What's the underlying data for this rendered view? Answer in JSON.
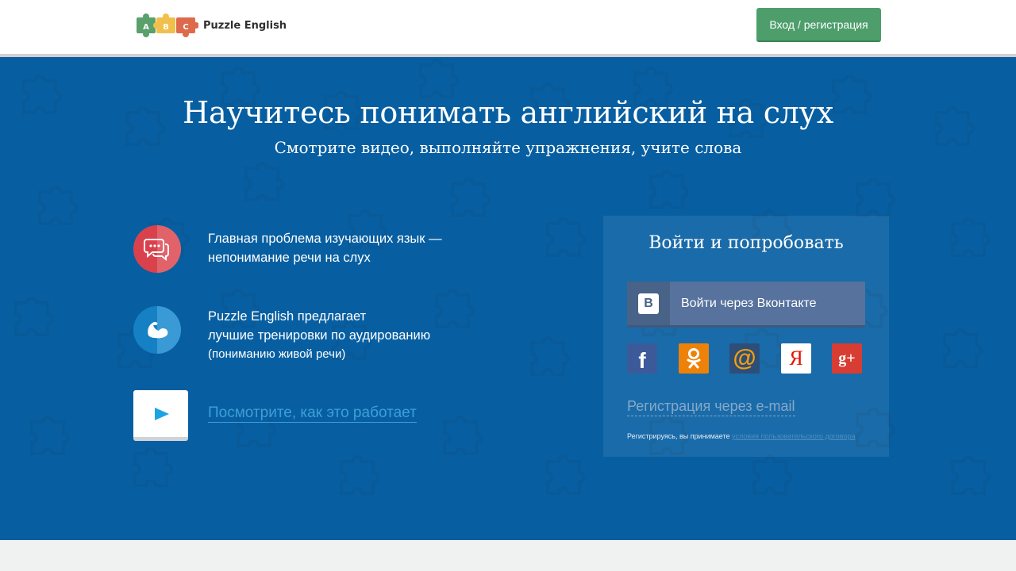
{
  "header": {
    "logo_letters": [
      "A",
      "B",
      "C"
    ],
    "logo_text": "Puzzle English",
    "login_label": "Вход / регистрация"
  },
  "hero": {
    "title": "Научитесь понимать английский на слух",
    "subtitle": "Смотрите видео, выполняйте упражнения, учите слова"
  },
  "features": [
    {
      "icon": "speech-bubbles-icon",
      "line1": "Главная проблема изучающих язык —",
      "line2": "непонимание речи на слух"
    },
    {
      "icon": "bicep-icon",
      "line1": "Puzzle English предлагает",
      "line2": "лучшие тренировки по аудированию",
      "line3": "(пониманию живой речи)"
    }
  ],
  "video": {
    "icon": "play-icon",
    "link": "Посмотрите, как это работает"
  },
  "login_panel": {
    "title": "Войти и попробовать",
    "vk_icon_letter": "В",
    "vk_label": "Войти через Вконтакте",
    "socials": [
      {
        "name": "facebook",
        "glyph": "f",
        "color": "#3c5a99"
      },
      {
        "name": "odnoklassniki",
        "glyph": "ok",
        "color": "#ee8208"
      },
      {
        "name": "mail-ru",
        "glyph": "@",
        "color": "#168de2"
      },
      {
        "name": "yandex",
        "glyph": "Я",
        "color": "#e61400"
      },
      {
        "name": "google-plus",
        "glyph": "g+",
        "color": "#d73d32"
      }
    ],
    "email_link": "Регистрация через e-mail",
    "terms_text": "Регистрируясь, вы принимаете",
    "terms_link": "условия пользовательского договора"
  },
  "colors": {
    "brand_blue": "#075fa2",
    "button_green": "#4e9e6c",
    "link_blue": "#3d9fd8"
  }
}
